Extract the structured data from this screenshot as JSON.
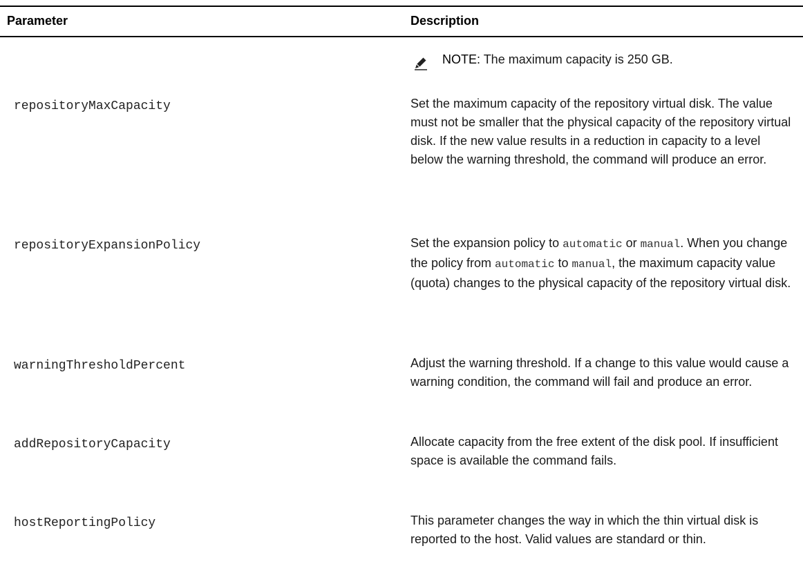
{
  "headers": {
    "parameter": "Parameter",
    "description": "Description"
  },
  "note": {
    "label": "NOTE:",
    "text": " The maximum capacity is 250 GB.",
    "icon": "pencil-note-icon"
  },
  "rows": [
    {
      "param": "repositoryMaxCapacity",
      "desc": "Set the maximum capacity of the repository virtual disk. The value must not be smaller that the physical capacity of the repository virtual disk. If the new value results in a reduction in capacity to a level below the warning threshold, the command will produce an error."
    },
    {
      "param": "repositoryExpansionPolicy",
      "desc_parts": {
        "p1": "Set the expansion policy to ",
        "c1": "automatic",
        "p2": " or ",
        "c2": "manual",
        "p3": ". When you change the policy from ",
        "c3": "automatic",
        "p4": " to ",
        "c4": "manual",
        "p5": ", the maximum capacity value (quota) changes to the physical capacity of the repository virtual disk."
      }
    },
    {
      "param": "warningThresholdPercent",
      "desc": "Adjust the warning threshold. If a change to this value would cause a warning condition, the command will fail and produce an error."
    },
    {
      "param": "addRepositoryCapacity",
      "desc": "Allocate capacity from the free extent of the disk pool. If insufficient space is available the command fails."
    },
    {
      "param": "hostReportingPolicy",
      "desc": "This parameter changes the way in which the thin virtual disk is reported to the host. Valid values are standard or thin."
    }
  ]
}
